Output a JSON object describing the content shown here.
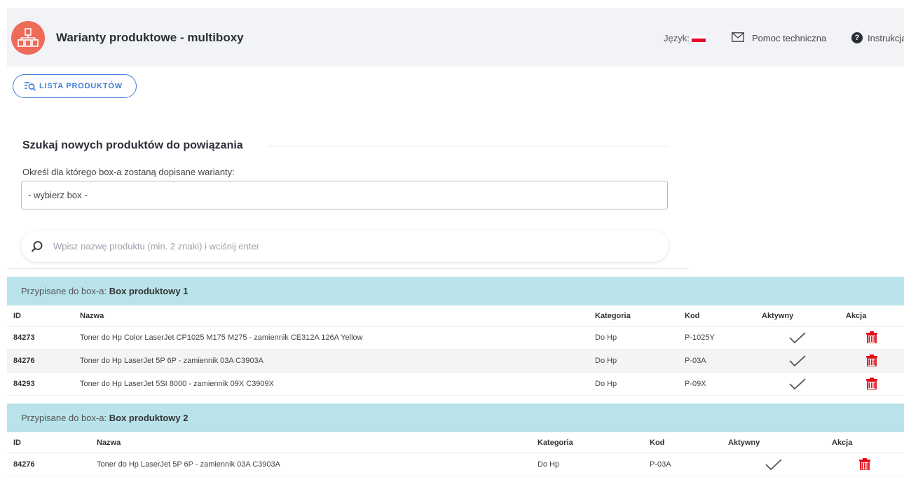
{
  "header": {
    "title": "Warianty produktowe - multiboxy",
    "lang_label": "Język:",
    "support_label": "Pomoc techniczna",
    "instructions_label": "Instrukcja"
  },
  "products_button": {
    "label": "LISTA PRODUKTÓW"
  },
  "search_section": {
    "title": "Szukaj nowych produktów do powiązania",
    "box_label": "Określ dla którego box-a zostaną dopisane warianty:",
    "box_selected": "- wybierz box -",
    "search_placeholder": "Wpisz nazwę produktu (min. 2 znaki) i wciśnij enter"
  },
  "assigned_prefix": "Przypisane do box-a:",
  "columns": {
    "id": "ID",
    "name": "Nazwa",
    "category": "Kategoria",
    "code": "Kod",
    "active": "Aktywny",
    "action": "Akcja"
  },
  "groups": [
    {
      "box_name": "Box produktowy 1",
      "rows": [
        {
          "id": "84273",
          "name": "Toner do Hp Color LaserJet CP1025 M175 M275 - zamiennik CE312A 126A Yellow",
          "category": "Do Hp",
          "code": "P-1025Y",
          "active": true
        },
        {
          "id": "84276",
          "name": "Toner do Hp LaserJet 5P 6P - zamiennik 03A C3903A",
          "category": "Do Hp",
          "code": "P-03A",
          "active": true
        },
        {
          "id": "84293",
          "name": "Toner do Hp LaserJet 5SI 8000 - zamiennik 09X C3909X",
          "category": "Do Hp",
          "code": "P-09X",
          "active": true
        }
      ]
    },
    {
      "box_name": "Box produktowy 2",
      "rows": [
        {
          "id": "84276",
          "name": "Toner do Hp LaserJet 5P 6P - zamiennik 03A C3903A",
          "category": "Do Hp",
          "code": "P-03A",
          "active": true
        }
      ]
    }
  ],
  "colors": {
    "accent": "#3d7fd8",
    "group_header": "#b9e3ea",
    "delete": "#e30a14",
    "logo": "#ee6b5a"
  }
}
